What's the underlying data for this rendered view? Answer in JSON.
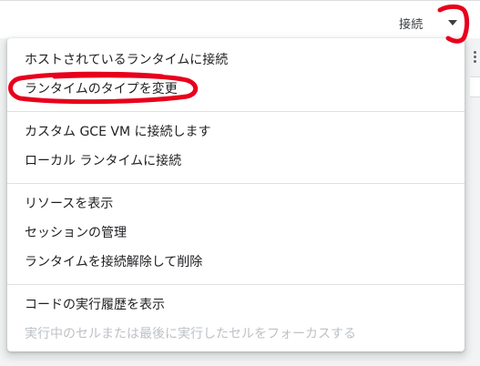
{
  "toolbar": {
    "connect_label": "接続",
    "dropdown_icon": "triangle-down-icon"
  },
  "menu": {
    "groups": [
      {
        "items": [
          {
            "label": "ホストされているランタイムに接続",
            "enabled": true
          },
          {
            "label": "ランタイムのタイプを変更",
            "enabled": true
          }
        ]
      },
      {
        "items": [
          {
            "label": "カスタム GCE VM に接続します",
            "enabled": true
          },
          {
            "label": "ローカル ランタイムに接続",
            "enabled": true
          }
        ]
      },
      {
        "items": [
          {
            "label": "リソースを表示",
            "enabled": true
          },
          {
            "label": "セッションの管理",
            "enabled": true
          },
          {
            "label": "ランタイムを接続解除して削除",
            "enabled": true
          }
        ]
      },
      {
        "items": [
          {
            "label": "コードの実行履歴を表示",
            "enabled": true
          },
          {
            "label": "実行中のセルまたは最後に実行したセルをフォーカスする",
            "enabled": false
          }
        ]
      }
    ]
  },
  "annotation_color": "#e8001c"
}
